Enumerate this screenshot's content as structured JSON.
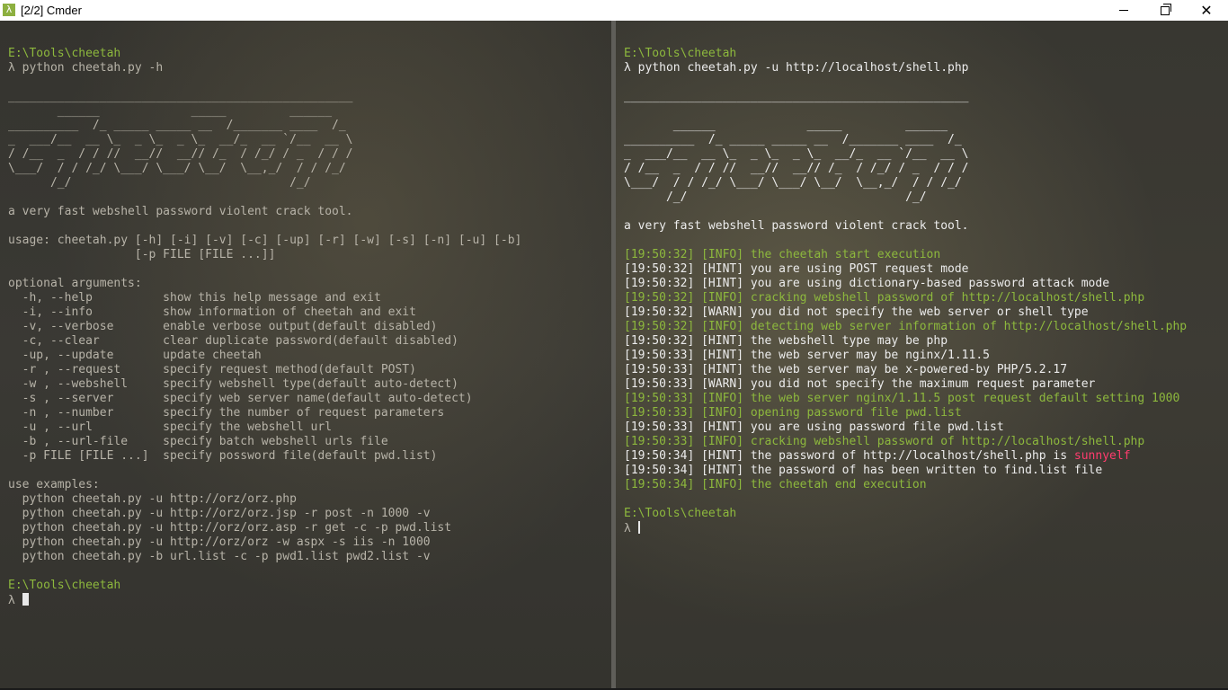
{
  "window": {
    "title": "[2/2] Cmder",
    "icon": "lambda-icon",
    "icon_glyph": "λ"
  },
  "colors": {
    "prompt_path": "#8db83d",
    "info": "#8db83d",
    "hint": "#ececec",
    "highlight": "#ff3c6e"
  },
  "left": {
    "prompt1_path": "E:\\Tools\\cheetah",
    "prompt1_cmd": "λ python cheetah.py -h",
    "banner": [
      "_________________________________________________",
      "       ______             _____         ______",
      "__________  /_ _____ _____ __  /_______ ____  /_",
      "_  ___/__  __ \\_  _ \\_  _ \\_  __/_  __ `/__  __ \\",
      "/ /__  _  / / //  __//  __// /_  / /_/ / _  / / /",
      "\\___/  / / /_/ \\___/ \\___/ \\__/  \\__,_/  / / /_/",
      "      /_/                               /_/"
    ],
    "tagline": "a very fast webshell password violent crack tool.",
    "usage": [
      "usage: cheetah.py [-h] [-i] [-v] [-c] [-up] [-r] [-w] [-s] [-n] [-u] [-b]",
      "                  [-p FILE [FILE ...]]"
    ],
    "optional_header": "optional arguments:",
    "options": [
      "  -h, --help          show this help message and exit",
      "  -i, --info          show information of cheetah and exit",
      "  -v, --verbose       enable verbose output(default disabled)",
      "  -c, --clear         clear duplicate password(default disabled)",
      "  -up, --update       update cheetah",
      "  -r , --request      specify request method(default POST)",
      "  -w , --webshell     specify webshell type(default auto-detect)",
      "  -s , --server       specify web server name(default auto-detect)",
      "  -n , --number       specify the number of request parameters",
      "  -u , --url          specify the webshell url",
      "  -b , --url-file     specify batch webshell urls file",
      "  -p FILE [FILE ...]  specify possword file(default pwd.list)"
    ],
    "examples_header": "use examples:",
    "examples": [
      "  python cheetah.py -u http://orz/orz.php",
      "  python cheetah.py -u http://orz/orz.jsp -r post -n 1000 -v",
      "  python cheetah.py -u http://orz/orz.asp -r get -c -p pwd.list",
      "  python cheetah.py -u http://orz/orz -w aspx -s iis -n 1000",
      "  python cheetah.py -b url.list -c -p pwd1.list pwd2.list -v"
    ],
    "prompt2_path": "E:\\Tools\\cheetah",
    "prompt2_lambda": "λ "
  },
  "right": {
    "prompt1_path": "E:\\Tools\\cheetah",
    "prompt1_cmd": "λ python cheetah.py -u http://localhost/shell.php",
    "banner": [
      "_________________________________________________",
      "       ______             _____         ______",
      "__________  /_ _____ _____ __  /_______ ____  /_",
      "_  ___/__  __ \\_  _ \\_  _ \\_  __/_  __ `/__  __ \\",
      "/ /__  _  / / //  __//  __// /_  / /_/ / _  / / /",
      "\\___/  / / /_/ \\___/ \\___/ \\__/  \\__,_/  / / /_/",
      "      /_/                               /_/"
    ],
    "tagline": "a very fast webshell password violent crack tool.",
    "log": [
      "[19:50:32] [INFO] the cheetah start execution",
      "[19:50:32] [HINT] you are using POST request mode",
      "[19:50:32] [HINT] you are using dictionary-based password attack mode",
      "[19:50:32] [INFO] cracking webshell password of http://localhost/shell.php",
      "[19:50:32] [WARN] you did not specify the web server or shell type",
      "[19:50:32] [INFO] detecting web server information of http://localhost/shell.php",
      "[19:50:32] [HINT] the webshell type may be php",
      "[19:50:33] [HINT] the web server may be nginx/1.11.5",
      "[19:50:33] [HINT] the web server may be x-powered-by PHP/5.2.17",
      "[19:50:33] [WARN] you did not specify the maximum request parameter",
      "[19:50:33] [INFO] the web server nginx/1.11.5 post request default setting 1000",
      "[19:50:33] [INFO] opening password file pwd.list",
      "[19:50:33] [HINT] you are using password file pwd.list",
      "[19:50:33] [INFO] cracking webshell password of http://localhost/shell.php",
      "[19:50:34] [HINT] the password of http://localhost/shell.php is ",
      "[19:50:34] [HINT] the password of has been written to find.list file",
      "[19:50:34] [INFO] the cheetah end execution"
    ],
    "found_password": "sunnyelf",
    "prompt2_path": "E:\\Tools\\cheetah",
    "prompt2_lambda": "λ "
  }
}
